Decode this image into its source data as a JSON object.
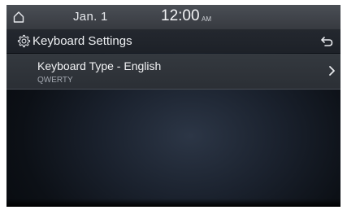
{
  "status_bar": {
    "date": "Jan.  1",
    "time": "12:00",
    "ampm": "AM",
    "home_icon": "home-icon"
  },
  "header": {
    "title": "Keyboard Settings",
    "settings_icon": "gear-icon",
    "back_icon": "back-icon"
  },
  "settings": [
    {
      "label": "Keyboard Type - English",
      "value": "QWERTY",
      "icon": "chevron-right-icon"
    }
  ],
  "colors": {
    "status_bar": "#3f4248",
    "header": "#1f232a",
    "row": "#303439",
    "text": "#f2f3f5",
    "subtext": "#a3a8b0",
    "background": "#0c1016"
  }
}
